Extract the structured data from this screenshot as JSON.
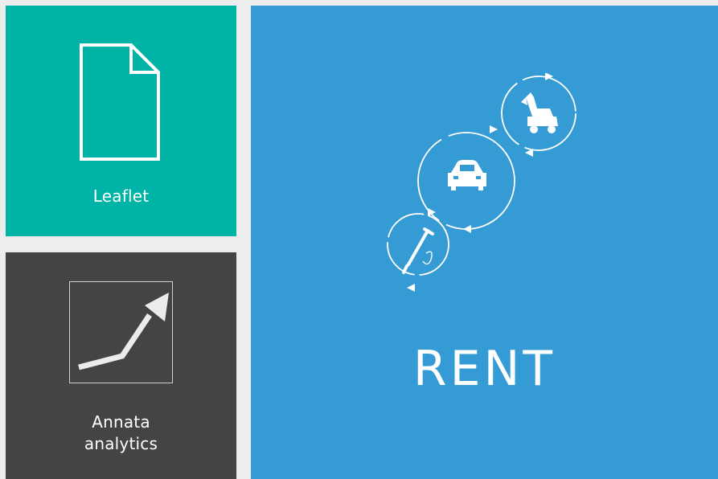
{
  "tiles": {
    "leaflet": {
      "label": "Leaflet",
      "icon": "document-icon",
      "color": "#00b3a7"
    },
    "analytics": {
      "label_line1": "Annata",
      "label_line2": "analytics",
      "icon": "trend-up-arrow-icon",
      "color": "#444446"
    },
    "rent": {
      "label": "RENT",
      "icon": "rental-cycle-icon",
      "sub_icons": [
        "jackhammer-icon",
        "car-icon",
        "wheel-loader-icon"
      ],
      "color": "#359bd5"
    }
  },
  "page": {
    "background": "#ededed"
  }
}
